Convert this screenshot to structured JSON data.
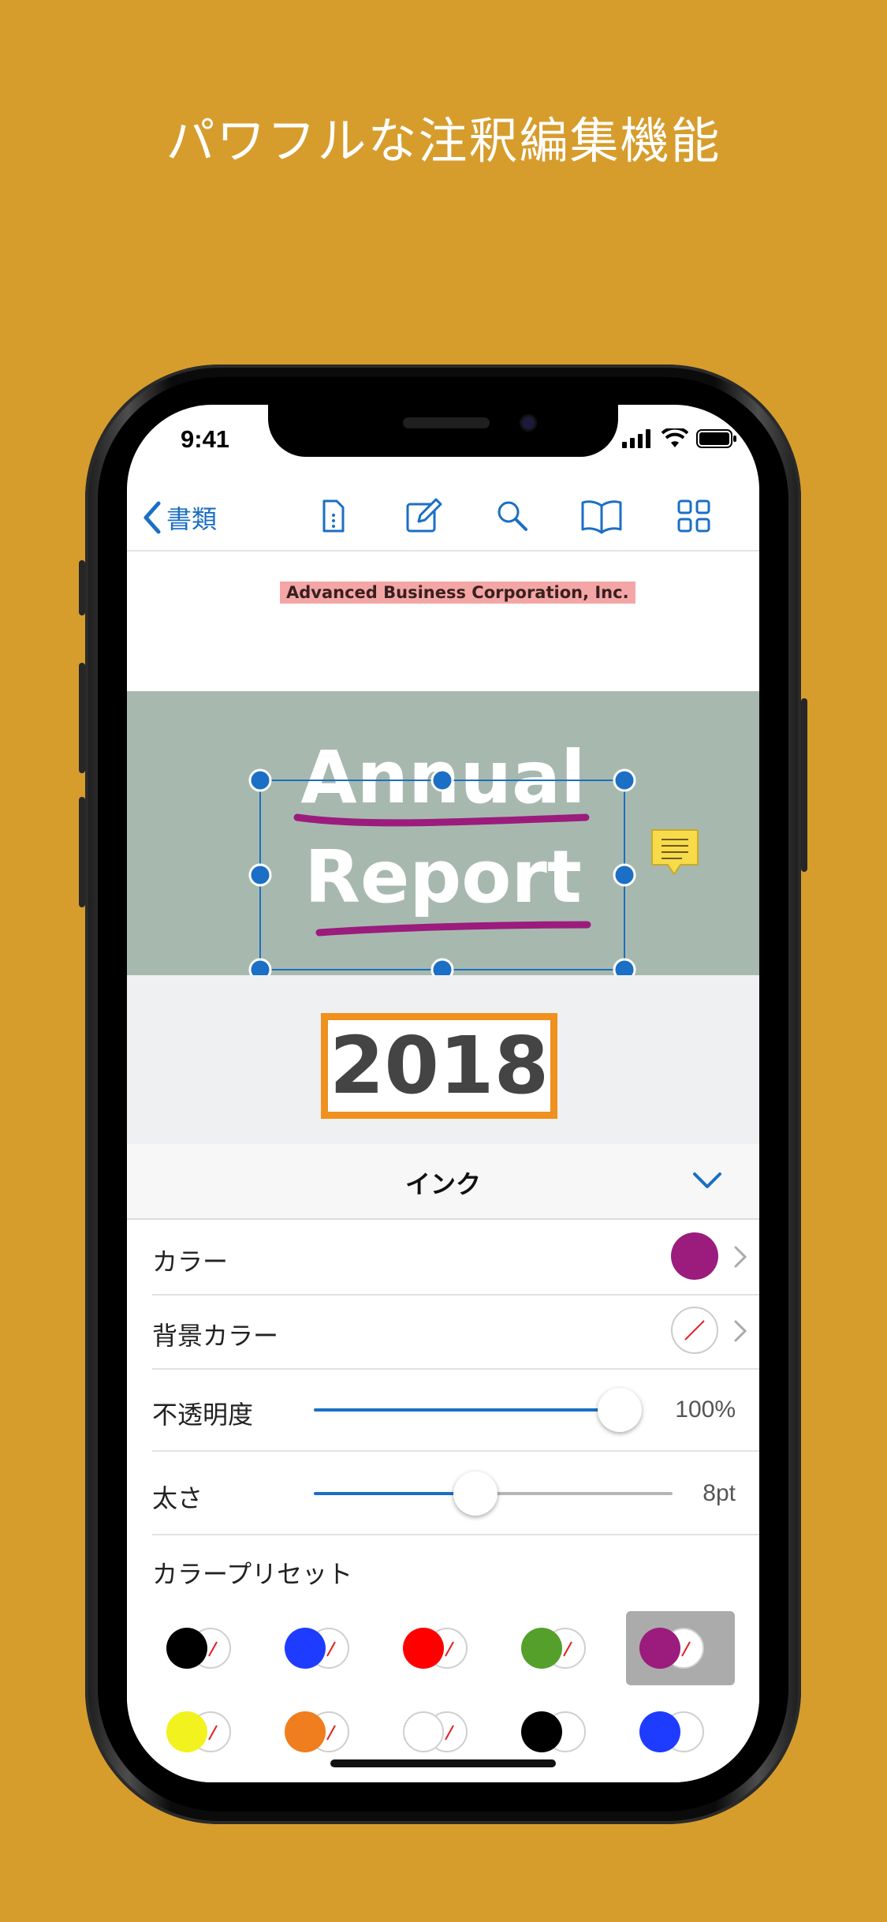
{
  "headline": "パワフルな注釈編集機能",
  "status": {
    "time": "9:41"
  },
  "toolbar": {
    "back_label": "書類",
    "icons": [
      "document-outline-icon",
      "edit-icon",
      "search-icon",
      "book-icon",
      "grid-icon"
    ]
  },
  "document": {
    "company": "Advanced Business Corporation, Inc.",
    "title_line1": "Annual",
    "title_line2": "Report",
    "year": "2018"
  },
  "panel": {
    "title": "インク",
    "rows": {
      "color": {
        "label": "カラー",
        "value_color": "#9B1C7D"
      },
      "background": {
        "label": "背景カラー"
      },
      "opacity": {
        "label": "不透明度",
        "value": "100%",
        "level": 1.0
      },
      "thickness": {
        "label": "太さ",
        "value": "8pt",
        "level": 0.44
      }
    },
    "presets_label": "カラープリセット",
    "presets": [
      {
        "fg": "#000000",
        "bg_none": true
      },
      {
        "fg": "#1E3CFF",
        "bg_none": true
      },
      {
        "fg": "#FF0000",
        "bg_none": true
      },
      {
        "fg": "#55A02A",
        "bg_none": true
      },
      {
        "fg": "#9B1C7D",
        "bg_none": true,
        "selected": true
      },
      {
        "fg": "#F2F21E",
        "bg_none": true
      },
      {
        "fg": "#F07D1E",
        "bg_none": true
      },
      {
        "fg": "#FFFFFF",
        "bg_none": true
      },
      {
        "fg": "#000000",
        "bg_none": false
      },
      {
        "fg": "#1E3CFF",
        "bg_none": false
      }
    ]
  },
  "colors": {
    "background": "#D69D2D",
    "accent": "#1B6FC4",
    "ink": "#9B1C7D",
    "highlight": "#F4A6A6",
    "box": "#F0901E"
  }
}
